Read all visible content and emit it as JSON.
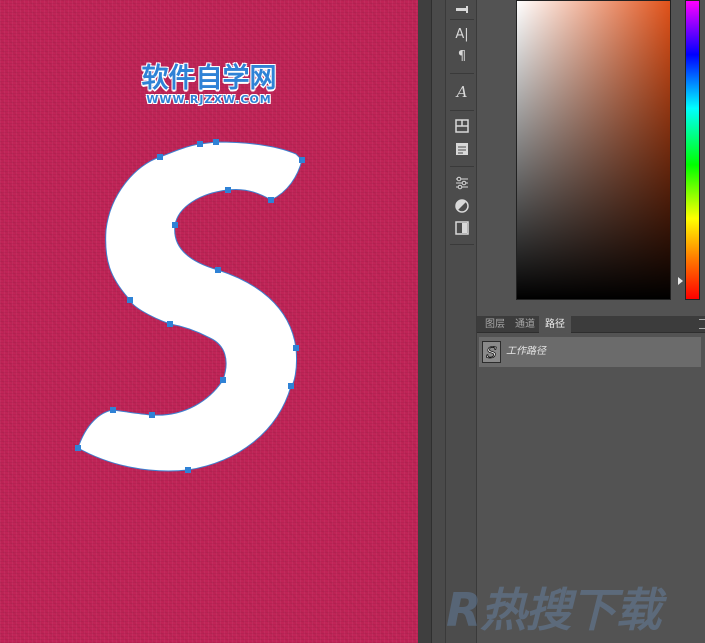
{
  "canvas": {
    "watermark_cn": "软件自学网",
    "watermark_url": "WWW.RJZXW.COM"
  },
  "toolbar": {
    "items": [
      {
        "name": "brush-preset-icon"
      },
      {
        "name": "character-panel-icon",
        "glyph": "A|"
      },
      {
        "name": "paragraph-panel-icon",
        "glyph": "¶"
      },
      {
        "name": "glyph-panel-icon",
        "glyph": "A"
      },
      {
        "name": "swatches-icon"
      },
      {
        "name": "notes-icon"
      },
      {
        "name": "properties-icon"
      },
      {
        "name": "adjustments-icon"
      },
      {
        "name": "mask-icon"
      }
    ]
  },
  "colors": {
    "canvas_bg": "#c02457",
    "anchor": "#2f82d6",
    "shape_fill": "#ffffff"
  },
  "panel": {
    "tabs": [
      {
        "label": "图层",
        "active": false
      },
      {
        "label": "通道",
        "active": false
      },
      {
        "label": "路径",
        "active": true
      }
    ],
    "paths": [
      {
        "name": "工作路径",
        "thumb_glyph": "S"
      }
    ]
  },
  "watermark_bottom": "R热搜下载"
}
